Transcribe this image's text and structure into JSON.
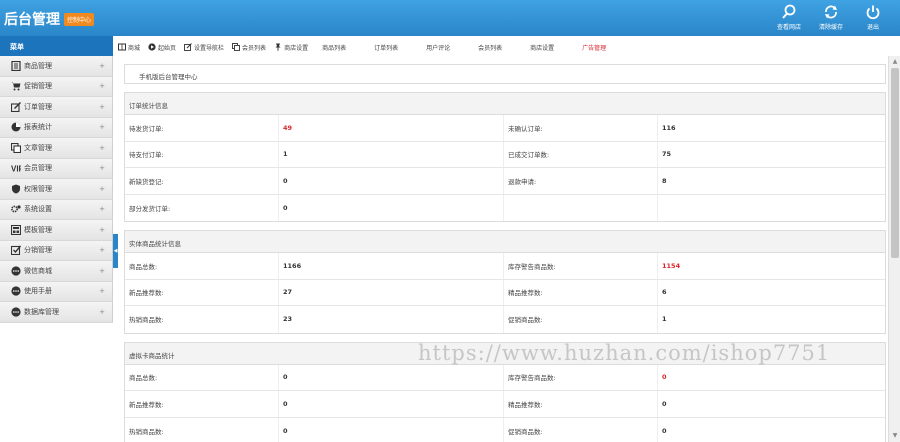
{
  "header": {
    "title": "后台管理",
    "badge": "控制中心",
    "actions": [
      {
        "label": "查看网店",
        "icon": "search-icon"
      },
      {
        "label": "清除缓存",
        "icon": "refresh-icon"
      },
      {
        "label": "退出",
        "icon": "power-icon"
      }
    ]
  },
  "sidebar": {
    "title": "菜单",
    "items": [
      {
        "label": "商品管理",
        "icon": "product-icon"
      },
      {
        "label": "促销管理",
        "icon": "cart-icon"
      },
      {
        "label": "订单管理",
        "icon": "edit-icon"
      },
      {
        "label": "报表统计",
        "icon": "chart-icon"
      },
      {
        "label": "文章管理",
        "icon": "copy-icon"
      },
      {
        "label": "会员管理",
        "icon": "vip-icon"
      },
      {
        "label": "权限管理",
        "icon": "shield-icon"
      },
      {
        "label": "系统设置",
        "icon": "gear-icon"
      },
      {
        "label": "模板管理",
        "icon": "template-icon"
      },
      {
        "label": "分销管理",
        "icon": "check-icon"
      },
      {
        "label": "微信商城",
        "icon": "more-icon"
      },
      {
        "label": "使用手册",
        "icon": "more-icon"
      },
      {
        "label": "数据库管理",
        "icon": "more-icon"
      }
    ],
    "plus": "+"
  },
  "toolbar": {
    "items": [
      {
        "label": "商城",
        "icon": "book-icon"
      },
      {
        "label": "起始页",
        "icon": "play-icon"
      },
      {
        "label": "设置导航栏",
        "icon": "edit-icon"
      },
      {
        "label": "会员列表",
        "icon": "copy-icon"
      },
      {
        "label": "商店设置",
        "icon": "pin-icon"
      }
    ],
    "plain_items": [
      "商品列表",
      "订单列表",
      "用户评论",
      "会员列表",
      "商店设置",
      "广告管理"
    ],
    "active_item": "广告管理"
  },
  "breadcrumb": "手机版后台管理中心",
  "panels": [
    {
      "title": "订单统计信息",
      "rows": [
        [
          "待发货订单:",
          "49",
          "未确认订单:",
          "116"
        ],
        [
          "待支付订单:",
          "1",
          "已成交订单数:",
          "75"
        ],
        [
          "新缺货登记:",
          "0",
          "退款申请:",
          "8"
        ],
        [
          "部分发货订单:",
          "0",
          "",
          ""
        ]
      ],
      "red_cells": [
        "0-1"
      ]
    },
    {
      "title": "实体商品统计信息",
      "rows": [
        [
          "商品总数:",
          "1166",
          "库存警告商品数:",
          "1154"
        ],
        [
          "新品推荐数:",
          "27",
          "精品推荐数:",
          "6"
        ],
        [
          "热销商品数:",
          "23",
          "促销商品数:",
          "1"
        ]
      ],
      "red_cells": [
        "0-3"
      ]
    },
    {
      "title": "虚拟卡商品统计",
      "rows": [
        [
          "商品总数:",
          "0",
          "库存警告商品数:",
          "0"
        ],
        [
          "新品推荐数:",
          "0",
          "精品推荐数:",
          "0"
        ],
        [
          "热销商品数:",
          "0",
          "促销商品数:",
          "0"
        ]
      ],
      "red_cells": [
        "0-3"
      ]
    }
  ],
  "watermark": "https://www.huzhan.com/ishop7751",
  "scroll": {
    "up": "▲",
    "down": "▼"
  },
  "collapse": "◀",
  "colors": {
    "header": "#2a86c8",
    "sidebar_head": "#1c75bc",
    "accent": "#d9252a",
    "badge": "#f08a1e"
  }
}
